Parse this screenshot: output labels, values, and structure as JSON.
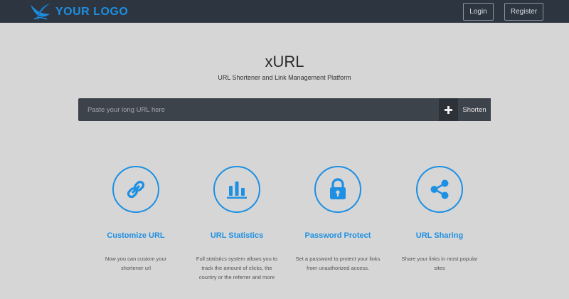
{
  "header": {
    "logo_text": "YOUR LOGO",
    "login_label": "Login",
    "register_label": "Register"
  },
  "hero": {
    "title": "xURL",
    "subtitle": "URL Shortener and Link Management Platform"
  },
  "shorten": {
    "placeholder": "Paste your long URL here",
    "plus_icon": "plus-icon",
    "button_label": "Shorten"
  },
  "features": [
    {
      "icon": "link-icon",
      "title": "Customize URL",
      "description": "Now you can custom your shortener url"
    },
    {
      "icon": "bar-chart-icon",
      "title": "URL Statistics",
      "description": "Full statistics system allows you to track the amount of clicks, the country or the referrer and more"
    },
    {
      "icon": "lock-icon",
      "title": "Password Protect",
      "description": "Set a password to protect your links from unauthorized access."
    },
    {
      "icon": "share-icon",
      "title": "URL Sharing",
      "description": "Share your links in most popular sites"
    }
  ],
  "colors": {
    "navbar": "#2d3640",
    "accent": "#1e90e3",
    "background": "#d6d6d6",
    "input_bar": "#3d434b"
  }
}
